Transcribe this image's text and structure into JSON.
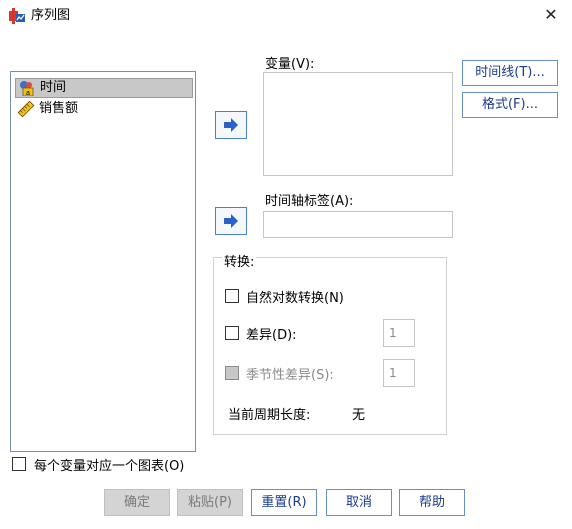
{
  "window": {
    "title": "序列图",
    "close_glyph": "✕"
  },
  "variables": [
    {
      "label": "时间",
      "icon": "date-variable-icon",
      "selected": true
    },
    {
      "label": "销售额",
      "icon": "scale-variable-icon",
      "selected": false
    }
  ],
  "fields": {
    "variables_label": "变量",
    "variables_key": "(V):",
    "time_axis_label": "时间轴标签",
    "time_axis_key": "(A):"
  },
  "side_buttons": {
    "time_lines": "时间线(T)...",
    "format": "格式(F)..."
  },
  "transform": {
    "heading": "转换:",
    "natural_log": "自然对数转换(N)",
    "difference": "差异(D):",
    "difference_value": "1",
    "seasonal_difference": "季节性差异(S):",
    "seasonal_value": "1",
    "period_label": "当前周期长度:",
    "period_value": "无"
  },
  "one_chart_per_variable": "每个变量对应一个图表(O)",
  "buttons": {
    "ok": "确定",
    "paste": "粘贴(P)",
    "reset": "重置(R)",
    "cancel": "取消",
    "help": "帮助"
  }
}
